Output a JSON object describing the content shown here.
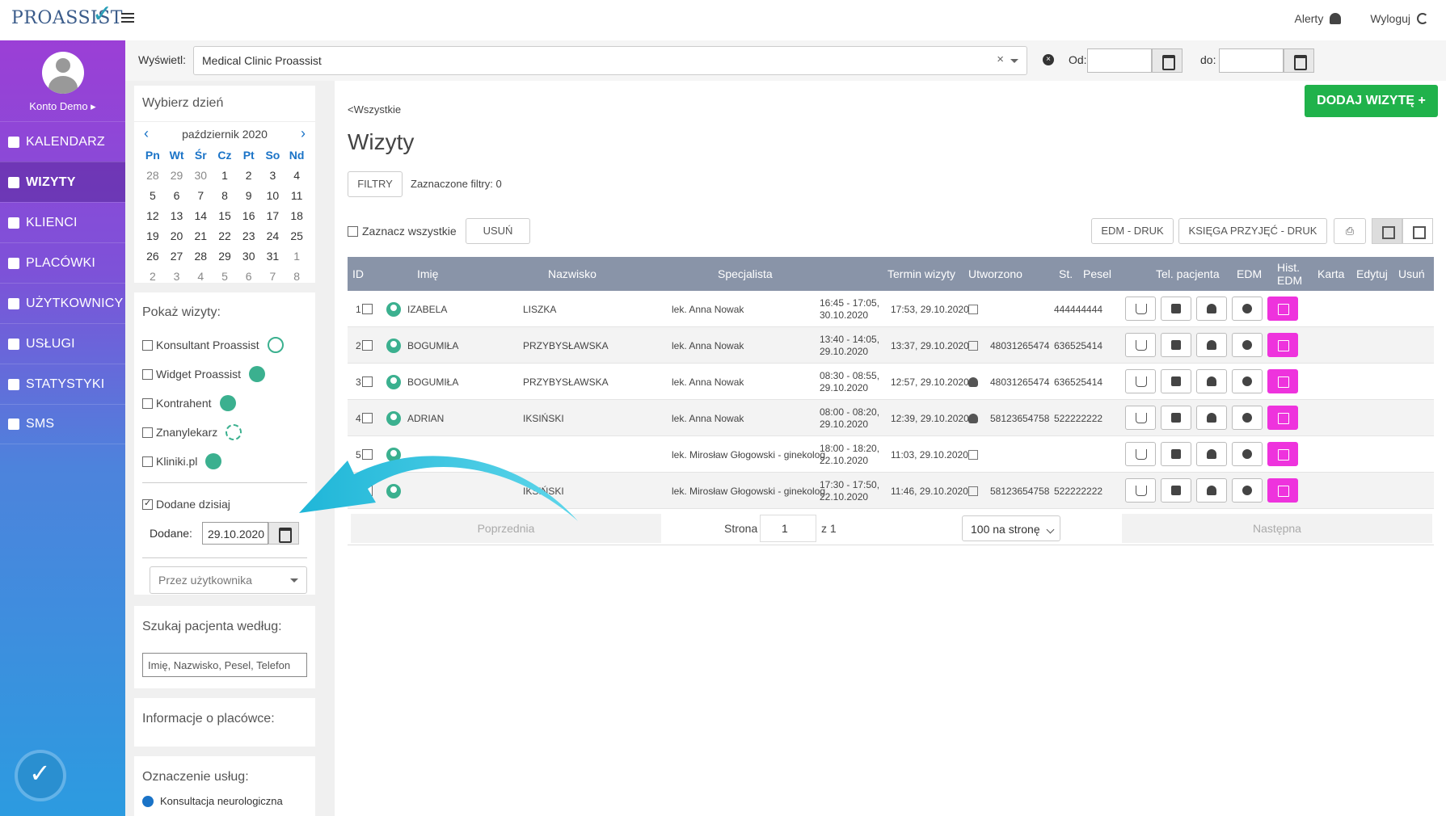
{
  "topbar": {
    "logo": "PROASSIST",
    "alerts": "Alerty",
    "logout": "Wyloguj"
  },
  "sidebar": {
    "user": "Konto Demo ▸",
    "items": [
      {
        "label": "KALENDARZ",
        "icon": "calendar-icon"
      },
      {
        "label": "WIZYTY",
        "icon": "list-icon"
      },
      {
        "label": "KLIENCI",
        "icon": "clients-icon"
      },
      {
        "label": "PLACÓWKI",
        "icon": "place-icon"
      },
      {
        "label": "UŻYTKOWNICY",
        "icon": "users-icon"
      },
      {
        "label": "USŁUGI",
        "icon": "services-icon"
      },
      {
        "label": "STATYSTYKI",
        "icon": "stats-icon"
      },
      {
        "label": "SMS",
        "icon": "phone-icon"
      }
    ]
  },
  "filterbar": {
    "display_label": "Wyświetl:",
    "clinic": "Medical Clinic Proassist",
    "from_label": "Od:",
    "to_label": "do:"
  },
  "day_picker": {
    "title": "Wybierz dzień",
    "month": "październik 2020",
    "weekdays": [
      "Pn",
      "Wt",
      "Śr",
      "Cz",
      "Pt",
      "So",
      "Nd"
    ],
    "weeks": [
      [
        "28",
        "29",
        "30",
        "1",
        "2",
        "3",
        "4"
      ],
      [
        "5",
        "6",
        "7",
        "8",
        "9",
        "10",
        "11"
      ],
      [
        "12",
        "13",
        "14",
        "15",
        "16",
        "17",
        "18"
      ],
      [
        "19",
        "20",
        "21",
        "22",
        "23",
        "24",
        "25"
      ],
      [
        "26",
        "27",
        "28",
        "29",
        "30",
        "31",
        "1"
      ],
      [
        "2",
        "3",
        "4",
        "5",
        "6",
        "7",
        "8"
      ]
    ]
  },
  "show_visits": {
    "title": "Pokaż wizyty:",
    "sources": [
      "Konsultant Proassist",
      "Widget Proassist",
      "Kontrahent",
      "Znanylekarz",
      "Kliniki.pl"
    ],
    "added_today": "Dodane dzisiaj",
    "added_label": "Dodane:",
    "added_value": "29.10.2020",
    "user_placeholder": "Przez użytkownika"
  },
  "search": {
    "title": "Szukaj pacjenta według:",
    "placeholder": "Imię, Nazwisko, Pesel, Telefon"
  },
  "facility": {
    "title": "Informacje o placówce:"
  },
  "services": {
    "title": "Oznaczenie usług:",
    "first": "Konsultacja neurologiczna"
  },
  "main": {
    "breadcrumb": "<Wszystkie",
    "title": "Wizyty",
    "add_button": "DODAJ WIZYTĘ +",
    "filters_button": "FILTRY",
    "filters_info": "Zaznaczone filtry: 0",
    "select_all": "Zaznacz wszystkie",
    "delete_button": "USUŃ",
    "edm_print": "EDM - DRUK",
    "book_print": "KSIĘGA PRZYJĘĆ - DRUK"
  },
  "table": {
    "headers": [
      "ID",
      "Imię",
      "Nazwisko",
      "Specjalista",
      "Termin wizyty",
      "Utworzono",
      "St.",
      "Pesel",
      "Tel. pacjenta",
      "EDM",
      "Hist.",
      "EDM",
      "Karta",
      "Edytuj",
      "Usuń"
    ],
    "rows": [
      {
        "id": "1",
        "first": "IZABELA",
        "last": "LISZKA",
        "spec": "lek. Anna Nowak",
        "term1": "16:45 - 17:05,",
        "term2": "30.10.2020",
        "created": "17:53, 29.10.2020",
        "status": "edit-icon",
        "pesel": "",
        "phone": "444444444"
      },
      {
        "id": "2",
        "first": "BOGUMIŁA",
        "last": "PRZYBYSŁAWSKA",
        "spec": "lek. Anna Nowak",
        "term1": "13:40 - 14:05,",
        "term2": "29.10.2020",
        "created": "13:37, 29.10.2020",
        "status": "edit-icon",
        "pesel": "48031265474",
        "phone": "636525414"
      },
      {
        "id": "3",
        "first": "BOGUMIŁA",
        "last": "PRZYBYSŁAWSKA",
        "spec": "lek. Anna Nowak",
        "term1": "08:30 - 08:55,",
        "term2": "29.10.2020",
        "created": "12:57, 29.10.2020",
        "status": "person-icon",
        "pesel": "48031265474",
        "phone": "636525414"
      },
      {
        "id": "4",
        "first": "ADRIAN",
        "last": "IKSIŃSKI",
        "spec": "lek. Anna Nowak",
        "term1": "08:00 - 08:20,",
        "term2": "29.10.2020",
        "created": "12:39, 29.10.2020",
        "status": "person-icon",
        "pesel": "58123654758",
        "phone": "522222222"
      },
      {
        "id": "5",
        "first": "",
        "last": "",
        "spec": "lek. Mirosław Głogowski - ginekolog",
        "term1": "18:00 - 18:20,",
        "term2": "22.10.2020",
        "created": "11:03, 29.10.2020",
        "status": "edit-icon",
        "pesel": "",
        "phone": ""
      },
      {
        "id": "6",
        "first": "",
        "last": "IKSIŃSKI",
        "spec": "lek. Mirosław Głogowski - ginekolog",
        "term1": "17:30 - 17:50,",
        "term2": "22.10.2020",
        "created": "11:46, 29.10.2020",
        "status": "edit-icon",
        "pesel": "58123654758",
        "phone": "522222222"
      }
    ]
  },
  "pager": {
    "prev": "Poprzednia",
    "page_label": "Strona",
    "page": "1",
    "of": "z 1",
    "per_page": "100 na stronę",
    "next": "Następna"
  }
}
